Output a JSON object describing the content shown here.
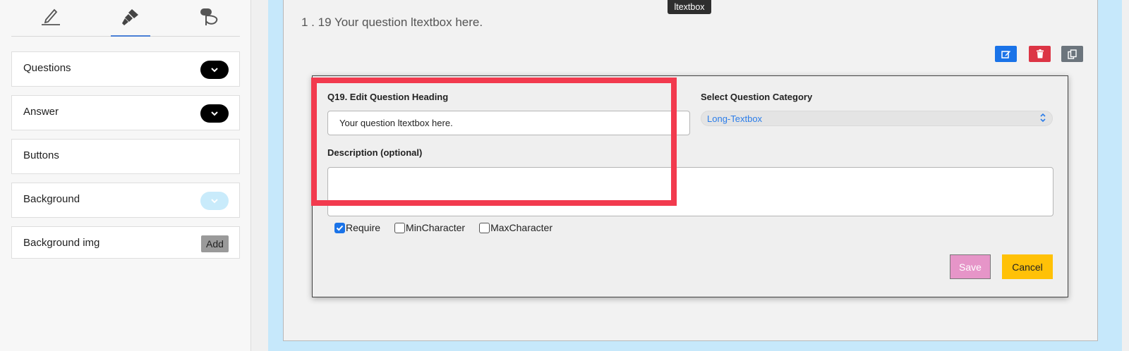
{
  "sidebar": {
    "tools": [
      {
        "icon": "pencil-icon"
      },
      {
        "icon": "paintbrush-icon",
        "active": true
      },
      {
        "icon": "logic-flow-icon"
      }
    ],
    "panels": [
      {
        "label": "Questions",
        "control": "chevron-toggle"
      },
      {
        "label": "Answer",
        "control": "chevron-toggle"
      },
      {
        "label": "Buttons"
      },
      {
        "label": "Background",
        "control": "chevron-toggle-light"
      },
      {
        "label": "Background img",
        "control": "add-button",
        "button_label": "Add"
      }
    ]
  },
  "question": {
    "title": "1 . 19 Your question ltextbox here.",
    "tooltip": "ltextbox"
  },
  "actions": {
    "edit_icon": "edit-icon",
    "delete_icon": "trash-icon",
    "copy_icon": "copy-icon"
  },
  "editor": {
    "heading_label": "Q19. Edit Question Heading",
    "heading_value": "Your question ltextbox here.",
    "category_label": "Select Question Category",
    "category_value": "Long-Textbox",
    "description_label": "Description (optional)",
    "description_value": "",
    "checkboxes": [
      {
        "label": "Require",
        "checked": true
      },
      {
        "label": "MinCharacter",
        "checked": false
      },
      {
        "label": "MaxCharacter",
        "checked": false
      }
    ],
    "save_label": "Save",
    "cancel_label": "Cancel"
  },
  "colors": {
    "canvas_bg": "#c6e8fb",
    "highlight": "#f23a4e",
    "edit_btn": "#1a73e8",
    "delete_btn": "#dc3545",
    "copy_btn": "#6c757d",
    "save_btn": "#e695c8",
    "cancel_btn": "#ffc107"
  }
}
